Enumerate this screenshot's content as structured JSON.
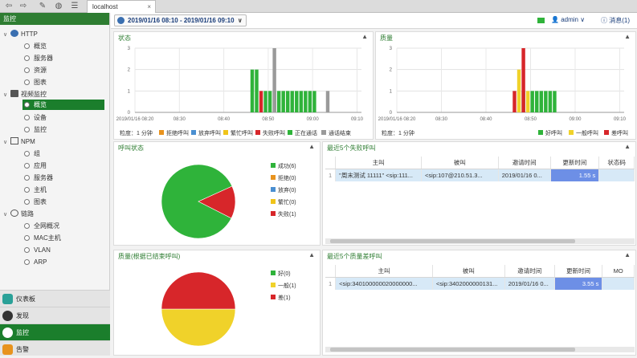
{
  "browser": {
    "tab_label": "localhost",
    "tab_close": "×"
  },
  "sidebar": {
    "header": "监控",
    "http": {
      "label": "HTTP",
      "items": [
        "概览",
        "服务器",
        "资源",
        "图表"
      ]
    },
    "video": {
      "label": "视频监控",
      "items": [
        "概览",
        "设备",
        "监控"
      ]
    },
    "npm": {
      "label": "NPM",
      "items": [
        "组",
        "应用",
        "服务器",
        "主机",
        "图表"
      ]
    },
    "link": {
      "label": "链路",
      "items": [
        "全网概况",
        "MAC主机",
        "VLAN",
        "ARP"
      ]
    },
    "bottom": [
      "仪表板",
      "发现",
      "监控",
      "告警"
    ]
  },
  "topbar": {
    "date_range": "2019/01/16 08:10 - 2019/01/16 09:10",
    "user": "admin",
    "messages": "消息(1)"
  },
  "status_panel": {
    "title": "状态",
    "granularity": "粒度：1 分钟",
    "legend": [
      "拒绝呼叫",
      "放弃呼叫",
      "繁忙呼叫",
      "失败呼叫",
      "正在通话",
      "通话结束"
    ],
    "colors": [
      "#e8931e",
      "#4a8fd1",
      "#f0c419",
      "#d7262a",
      "#2fb33a",
      "#9a9a9a"
    ]
  },
  "quality_panel": {
    "title": "质量",
    "granularity": "粒度：1 分钟",
    "legend": [
      "好呼叫",
      "一般呼叫",
      "差呼叫"
    ],
    "colors": [
      "#2fb33a",
      "#f0d22a",
      "#d7262a"
    ]
  },
  "chart_data": [
    {
      "type": "bar",
      "title": "状态",
      "x_ticks": [
        "2019/01/16 08:20",
        "08:30",
        "08:40",
        "08:50",
        "09:00",
        "09:10"
      ],
      "ylim": [
        0,
        3
      ],
      "y_ticks": [
        "0",
        "1",
        "2",
        "3"
      ],
      "series": [
        {
          "name": "正在通话",
          "x": [
            "08:46",
            "08:47",
            "08:49",
            "08:50",
            "08:51",
            "08:52",
            "08:53",
            "08:54",
            "08:55",
            "08:56",
            "08:57",
            "08:58",
            "08:59",
            "09:00"
          ],
          "values": [
            2,
            2,
            1,
            1,
            1,
            1,
            1,
            1,
            1,
            1,
            1,
            1,
            1,
            1
          ]
        },
        {
          "name": "失败呼叫",
          "x": [
            "08:48"
          ],
          "values": [
            1
          ]
        },
        {
          "name": "通话结束",
          "x": [
            "08:51",
            "09:03"
          ],
          "values": [
            3,
            1
          ]
        }
      ]
    },
    {
      "type": "bar",
      "title": "质量",
      "x_ticks": [
        "2019/01/16 08:20",
        "08:30",
        "08:40",
        "08:50",
        "09:00",
        "09:10"
      ],
      "ylim": [
        0,
        3
      ],
      "y_ticks": [
        "0",
        "1",
        "2",
        "3"
      ],
      "series": [
        {
          "name": "好呼叫",
          "x": [
            "08:48",
            "08:50",
            "08:51",
            "08:52",
            "08:53",
            "08:54",
            "08:55"
          ],
          "values": [
            1,
            1,
            1,
            1,
            1,
            1,
            1
          ]
        },
        {
          "name": "一般呼叫",
          "x": [
            "08:47",
            "08:49"
          ],
          "values": [
            2,
            1
          ]
        },
        {
          "name": "差呼叫",
          "x": [
            "08:46",
            "08:48"
          ],
          "values": [
            1,
            3
          ]
        }
      ]
    },
    {
      "type": "pie",
      "title": "呼叫状态",
      "labels": [
        "成功(6)",
        "拒绝(0)",
        "放弃(0)",
        "繁忙(0)",
        "失败(1)"
      ],
      "values": [
        6,
        0,
        0,
        0,
        1
      ],
      "colors": [
        "#2fb33a",
        "#e8931e",
        "#4a8fd1",
        "#f0c419",
        "#d7262a"
      ]
    },
    {
      "type": "pie",
      "title": "质量(根据已结束呼叫)",
      "labels": [
        "好(0)",
        "一般(1)",
        "差(1)"
      ],
      "values": [
        0,
        1,
        1
      ],
      "colors": [
        "#2fb33a",
        "#f0d22a",
        "#d7262a"
      ]
    }
  ],
  "fail_calls": {
    "title": "最近5个失败呼叫",
    "columns": [
      "主叫",
      "被叫",
      "邀请时间",
      "更新时间",
      "状态码"
    ],
    "rows": [
      {
        "idx": "1",
        "caller": "\"周末测试 11111\" <sip:111...",
        "callee": "<sip:107@210.51.3...",
        "invite": "2019/01/16 0...",
        "update": "1.55 s"
      }
    ]
  },
  "bad_calls": {
    "title": "最近5个质量差呼叫",
    "columns": [
      "主叫",
      "被叫",
      "邀请时间",
      "更新时间",
      "MO"
    ],
    "rows": [
      {
        "idx": "1",
        "caller": "<sip:340100000020000000...",
        "callee": "<sip:3402000000131...",
        "invite": "2019/01/16 0...",
        "update": "3.55 s"
      }
    ]
  }
}
